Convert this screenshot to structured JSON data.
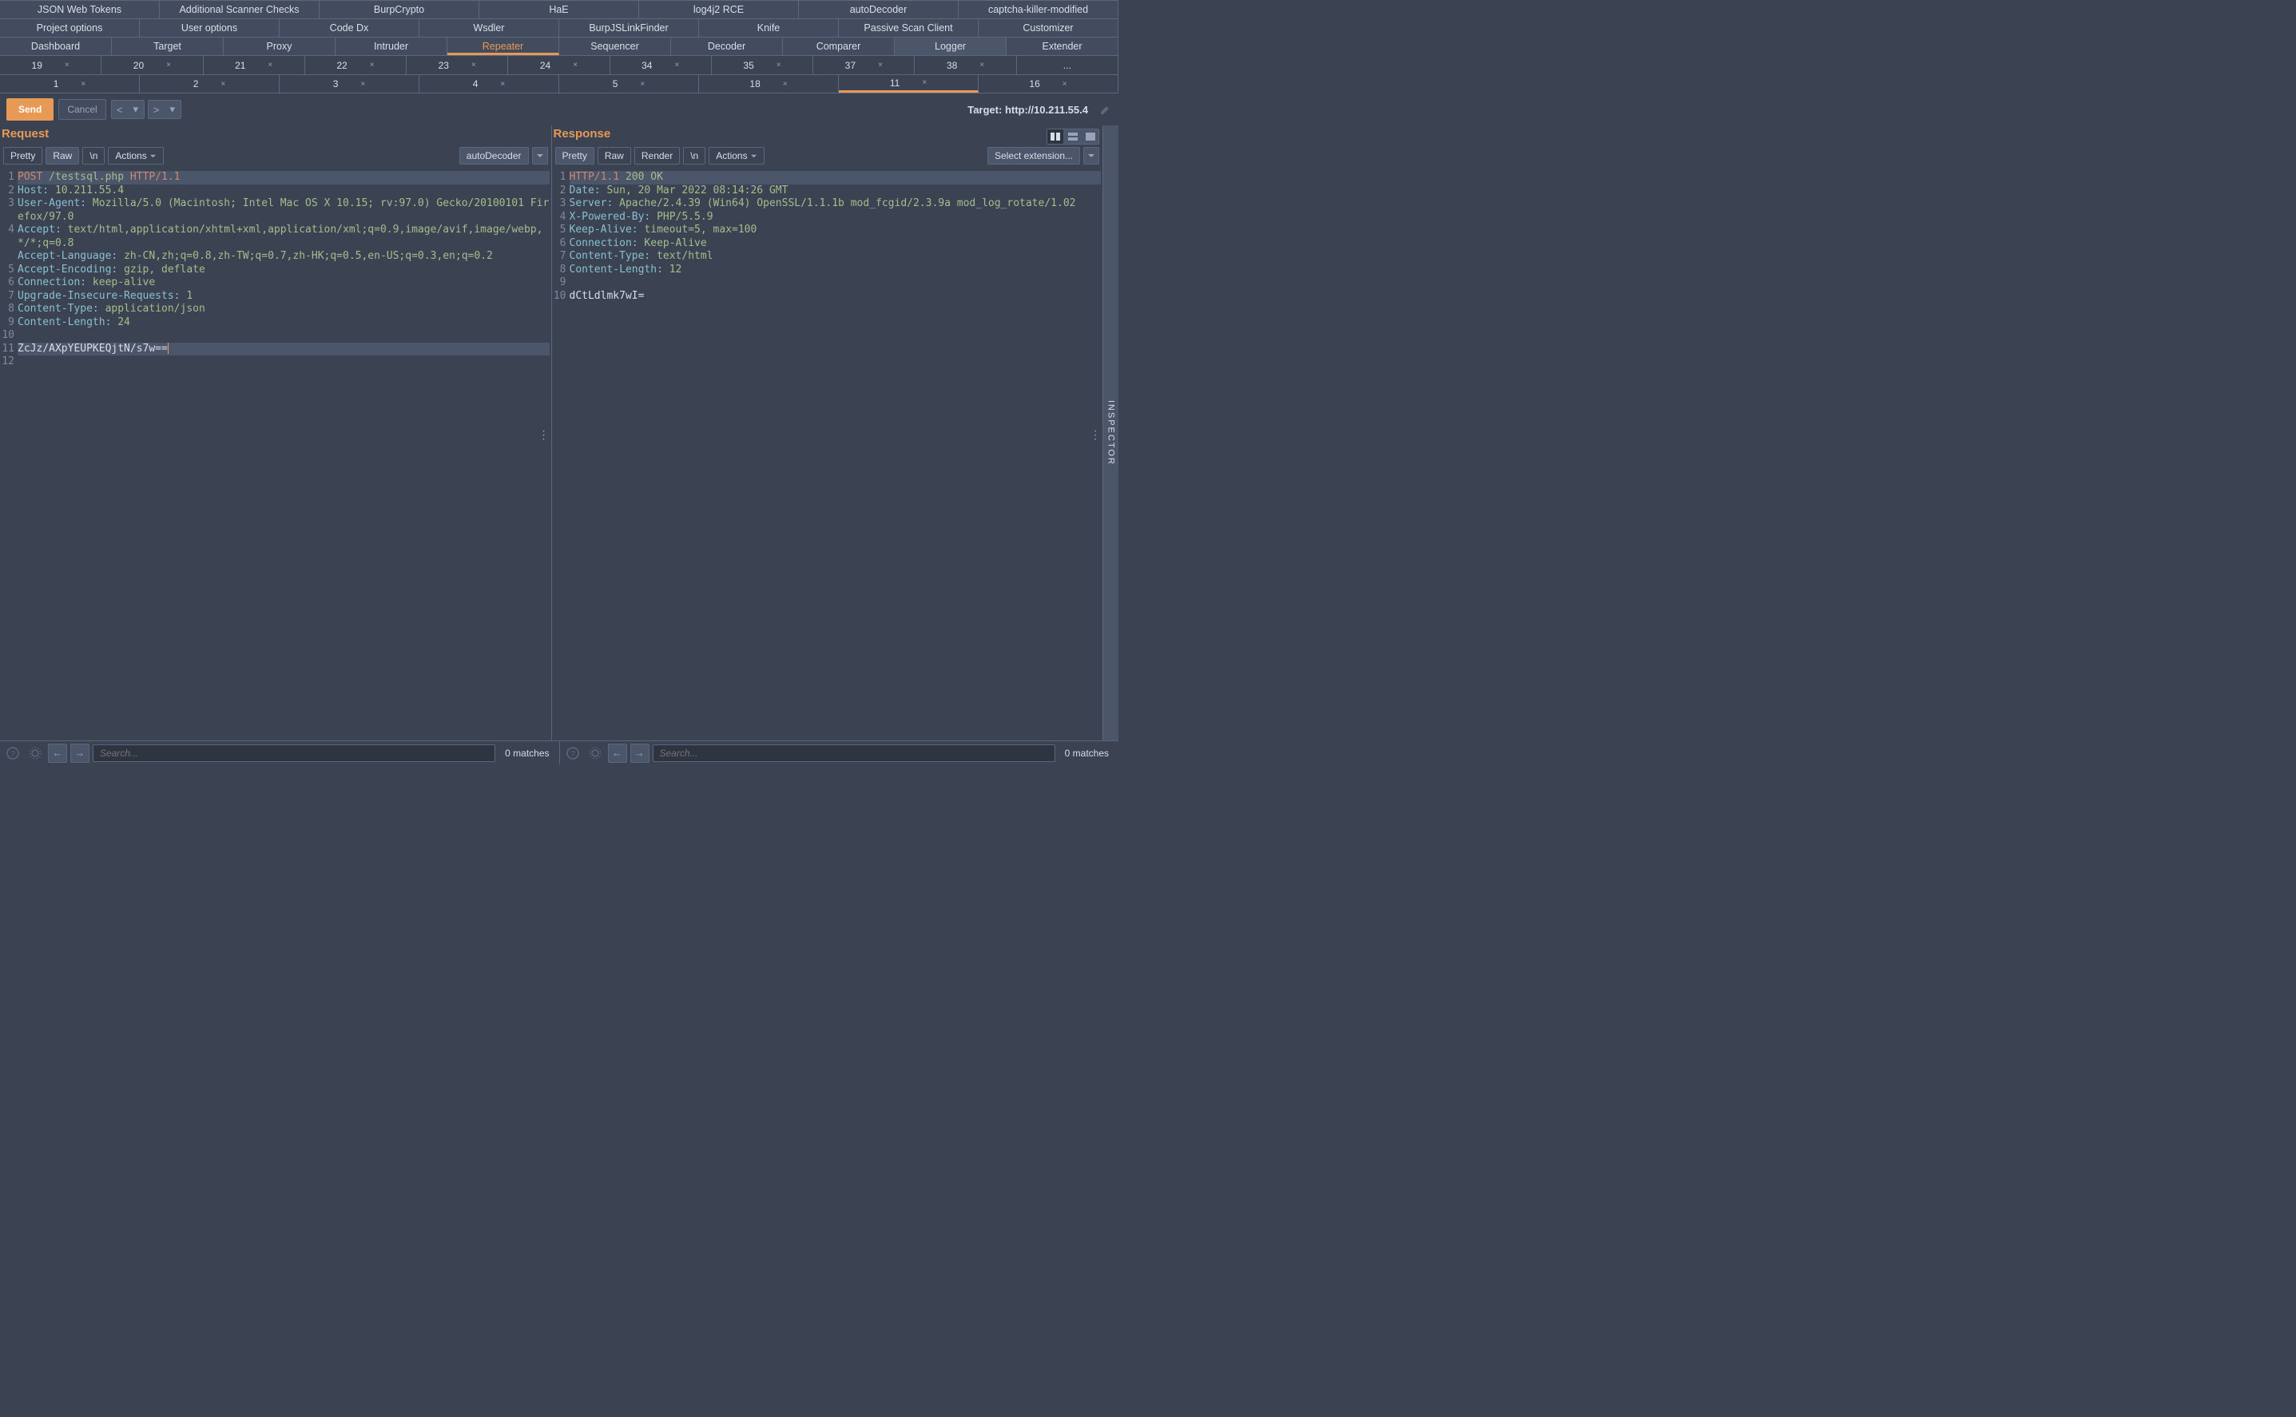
{
  "tabs": {
    "row1": [
      "JSON Web Tokens",
      "Additional Scanner Checks",
      "BurpCrypto",
      "HaE",
      "log4j2 RCE",
      "autoDecoder",
      "captcha-killer-modified"
    ],
    "row2": [
      "Project options",
      "User options",
      "Code Dx",
      "Wsdler",
      "BurpJSLinkFinder",
      "Knife",
      "Passive Scan Client",
      "Customizer"
    ],
    "row3": [
      "Dashboard",
      "Target",
      "Proxy",
      "Intruder",
      "Repeater",
      "Sequencer",
      "Decoder",
      "Comparer",
      "Logger",
      "Extender"
    ],
    "row3_active": "Repeater",
    "row3_highlight": "Logger"
  },
  "numtabs": {
    "row1": [
      "19",
      "20",
      "21",
      "22",
      "23",
      "24",
      "34",
      "35",
      "37",
      "38",
      "..."
    ],
    "row2": [
      "1",
      "2",
      "3",
      "4",
      "5",
      "18",
      "11",
      "16"
    ],
    "row2_active": "11"
  },
  "actions": {
    "send": "Send",
    "cancel": "Cancel",
    "target_prefix": "Target: ",
    "target_url": "http://10.211.55.4"
  },
  "panel": {
    "request": {
      "title": "Request",
      "tabs": [
        "Pretty",
        "Raw",
        "\\n",
        "Actions"
      ],
      "tabs_active": "Raw",
      "decoder": "autoDecoder"
    },
    "response": {
      "title": "Response",
      "tabs": [
        "Pretty",
        "Raw",
        "Render",
        "\\n",
        "Actions"
      ],
      "tabs_active": "Pretty",
      "extension": "Select extension..."
    }
  },
  "request_lines": [
    {
      "n": 1,
      "html": "<span class='firstline'><span class='method'>POST</span> <span class='hval'>/testsql.php</span> <span class='method'>HTTP/1.1</span></span>"
    },
    {
      "n": 2,
      "html": "<span class='hname'>Host:</span> <span class='hval'>10.211.55.4</span>"
    },
    {
      "n": 3,
      "html": "<span class='hname'>User-Agent:</span> <span class='hval'>Mozilla/5.0 (Macintosh; Intel Mac OS X 10.15; rv:97.0) Gecko/20100101 Firefox/97.0</span>",
      "wrap": 2
    },
    {
      "n": 4,
      "html": "<span class='hname'>Accept:</span> <span class='hval'>text/html,application/xhtml+xml,application/xml;q=0.9,image/avif,image/webp,*/*;q=0.8</span>",
      "wrap": 3
    },
    {
      "n": 5,
      "html": "<span class='hname'>Accept-Language:</span> <span class='hval'>zh-CN,zh;q=0.8,zh-TW;q=0.7,zh-HK;q=0.5,en-US;q=0.3,en;q=0.2</span>"
    },
    {
      "n": 6,
      "html": "<span class='hname'>Accept-Encoding:</span> <span class='hval'>gzip, deflate</span>"
    },
    {
      "n": 7,
      "html": "<span class='hname'>Connection:</span> <span class='hval'>keep-alive</span>"
    },
    {
      "n": 8,
      "html": "<span class='hname'>Upgrade-Insecure-Requests:</span> <span class='hval'>1</span>"
    },
    {
      "n": 9,
      "html": "<span class='hname'>Content-Type:</span> <span class='hval'>application/json</span>"
    },
    {
      "n": 10,
      "html": "<span class='hname'>Content-Length:</span> <span class='hval'>24</span>"
    },
    {
      "n": 11,
      "html": ""
    },
    {
      "n": 12,
      "html": "<span class='cursorline'><span class='data'>ZcJz/AXpYEUPKEQjtN/s7w==</span><span class='cursor'></span></span>"
    }
  ],
  "response_lines": [
    {
      "n": 1,
      "html": "<span class='firstline'><span class='method'>HTTP/1.1</span> <span class='hval'>200 OK</span></span>"
    },
    {
      "n": 2,
      "html": "<span class='hname'>Date:</span> <span class='hval'>Sun, 20 Mar 2022 08:14:26 GMT</span>"
    },
    {
      "n": 3,
      "html": "<span class='hname'>Server:</span> <span class='hval'>Apache/2.4.39 (Win64) OpenSSL/1.1.1b mod_fcgid/2.3.9a mod_log_rotate/1.02</span>"
    },
    {
      "n": 4,
      "html": "<span class='hname'>X-Powered-By:</span> <span class='hval'>PHP/5.5.9</span>"
    },
    {
      "n": 5,
      "html": "<span class='hname'>Keep-Alive:</span> <span class='hval'>timeout=5, max=100</span>"
    },
    {
      "n": 6,
      "html": "<span class='hname'>Connection:</span> <span class='hval'>Keep-Alive</span>"
    },
    {
      "n": 7,
      "html": "<span class='hname'>Content-Type:</span> <span class='hval'>text/html</span>"
    },
    {
      "n": 8,
      "html": "<span class='hname'>Content-Length:</span> <span class='hval'>12</span>"
    },
    {
      "n": 9,
      "html": ""
    },
    {
      "n": 10,
      "html": "<span class='data'>dCtLdlmk7wI=</span>"
    }
  ],
  "search": {
    "placeholder": "Search...",
    "matches": "0 matches"
  },
  "inspector_label": "INSPECTOR"
}
